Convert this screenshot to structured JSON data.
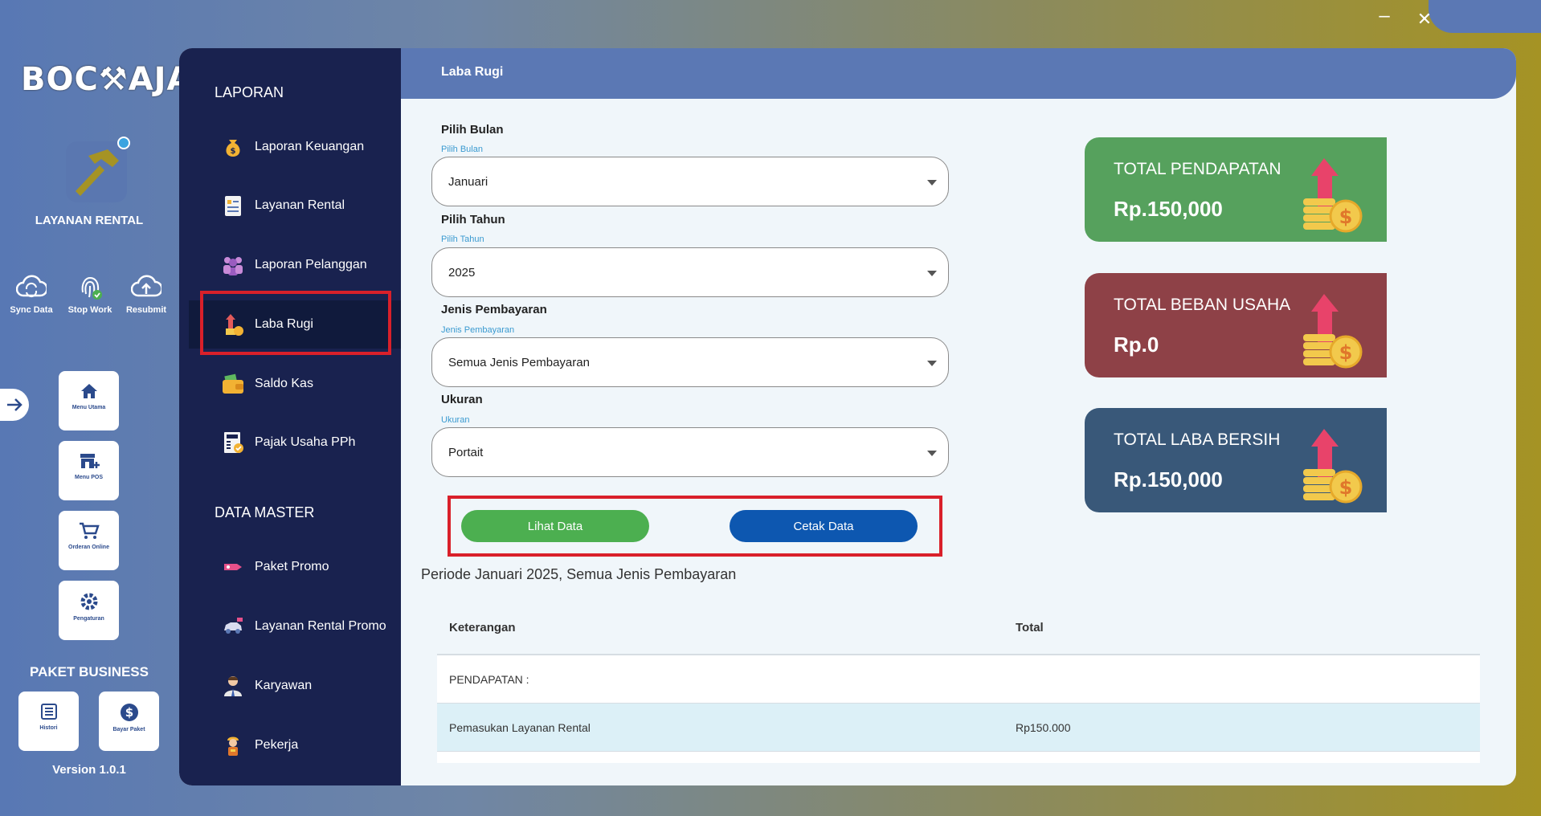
{
  "window": {
    "minimize": "–",
    "close": "✕"
  },
  "brand": {
    "logo_text": "BOC⚒AJA",
    "app_title": "LAYANAN RENTAL"
  },
  "quick_actions": [
    {
      "label": "Sync Data",
      "icon": "cloud-sync-icon"
    },
    {
      "label": "Stop Work",
      "icon": "fingerprint-icon"
    },
    {
      "label": "Resubmit",
      "icon": "cloud-upload-icon"
    }
  ],
  "rail_menu": [
    {
      "label": "Menu Utama",
      "icon": "home-icon"
    },
    {
      "label": "Menu POS",
      "icon": "store-icon"
    },
    {
      "label": "Orderan Online",
      "icon": "cart-icon"
    },
    {
      "label": "Pengaturan",
      "icon": "gear-icon"
    }
  ],
  "paket": {
    "title": "PAKET BUSINESS",
    "items": [
      {
        "label": "Histori",
        "icon": "list-icon"
      },
      {
        "label": "Bayar Paket",
        "icon": "dollar-icon"
      }
    ]
  },
  "version": "Version 1.0.1",
  "sidebar": {
    "laporan_title": "LAPORAN",
    "laporan_items": [
      {
        "label": "Laporan Keuangan",
        "icon": "money-bag-icon"
      },
      {
        "label": "Layanan Rental",
        "icon": "clipboard-icon"
      },
      {
        "label": "Laporan Pelanggan",
        "icon": "customers-icon"
      },
      {
        "label": "Laba Rugi",
        "icon": "profit-icon",
        "active": true
      },
      {
        "label": "Saldo Kas",
        "icon": "wallet-icon"
      },
      {
        "label": "Pajak Usaha PPh",
        "icon": "tax-icon"
      }
    ],
    "master_title": "DATA MASTER",
    "master_items": [
      {
        "label": "Paket Promo",
        "icon": "promo-tag-icon"
      },
      {
        "label": "Layanan Rental Promo",
        "icon": "car-promo-icon"
      },
      {
        "label": "Karyawan",
        "icon": "employee-icon"
      },
      {
        "label": "Pekerja",
        "icon": "worker-icon"
      }
    ]
  },
  "header": {
    "title": "Laba Rugi"
  },
  "form": {
    "bulan": {
      "label": "Pilih Bulan",
      "sub": "Pilih Bulan",
      "value": "Januari"
    },
    "tahun": {
      "label": "Pilih Tahun",
      "sub": "Pilih Tahun",
      "value": "2025"
    },
    "jenis": {
      "label": "Jenis Pembayaran",
      "sub": "Jenis Pembayaran",
      "value": "Semua Jenis Pembayaran"
    },
    "ukuran": {
      "label": "Ukuran",
      "sub": "Ukuran",
      "value": "Portait"
    }
  },
  "buttons": {
    "lihat": "Lihat Data",
    "cetak": "Cetak Data"
  },
  "periode": "Periode Januari 2025, Semua Jenis Pembayaran",
  "table": {
    "headers": [
      "Keterangan",
      "Total"
    ],
    "rows": [
      {
        "keterangan": "PENDAPATAN :",
        "total": ""
      },
      {
        "keterangan": "Pemasukan Layanan Rental",
        "total": "Rp150.000"
      }
    ]
  },
  "cards": [
    {
      "label": "TOTAL PENDAPATAN",
      "value": "Rp.150,000",
      "color": "#56a15d"
    },
    {
      "label": "TOTAL BEBAN USAHA",
      "value": "Rp.0",
      "color": "#8e4147"
    },
    {
      "label": "TOTAL LABA BERSIH",
      "value": "Rp.150,000",
      "color": "#395879"
    }
  ]
}
